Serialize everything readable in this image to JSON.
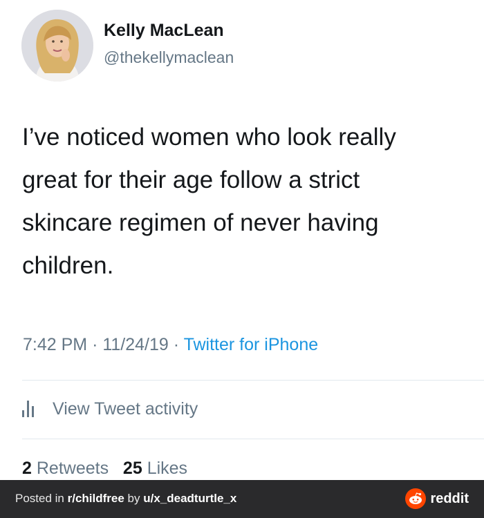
{
  "tweet": {
    "author_name": "Kelly MacLean",
    "author_handle": "@thekellymaclean",
    "text_lines": [
      "I’ve noticed women who look really",
      "great for their age follow a strict",
      "skincare regimen of never having",
      "children."
    ],
    "time": "7:42 PM",
    "date": "11/24/19",
    "source": "Twitter for iPhone",
    "sep": "·",
    "activity_label": "View Tweet activity",
    "activity_icon": "bar-chart-icon",
    "retweets_count": "2",
    "retweets_label": "Retweets",
    "likes_count": "25",
    "likes_label": "Likes"
  },
  "footer": {
    "posted_prefix": "Posted in ",
    "subreddit": "r/childfree",
    "by_text": " by ",
    "user": "u/x_deadturtle_x",
    "brand": "reddit",
    "brand_icon": "reddit-alien-icon"
  },
  "colors": {
    "text": "#14171a",
    "muted": "#657786",
    "link": "#1b95e0",
    "footer_bg": "#2a2a2c",
    "reddit_orange": "#ff4500"
  }
}
